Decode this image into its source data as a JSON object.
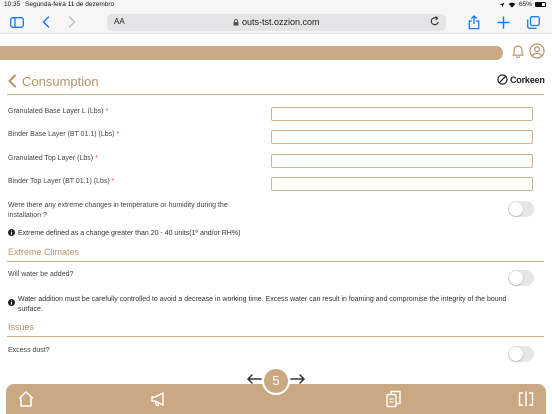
{
  "status_bar": {
    "time": "10:35",
    "date": "Segunda-feira 11 de dezembro",
    "battery": "65%"
  },
  "browser": {
    "text_size_label": "AA",
    "url": "outs-tst.ozzion.com"
  },
  "page": {
    "title": "Consumption",
    "logo_text": "Corkeen"
  },
  "fields": [
    {
      "label": "Granulated Base Layer L (Lbs)",
      "value": "",
      "required_mark": "*"
    },
    {
      "label": "Binder Base Layer (BT 01.1) (Lbs)",
      "value": "",
      "required_mark": "*"
    },
    {
      "label": "Granulated Top Layer  (Lbs)",
      "value": "",
      "required_mark": "*"
    },
    {
      "label": "Binder Top Layer (BT 01.1) (Lbs)",
      "value": "",
      "required_mark": "*"
    }
  ],
  "questions": {
    "extreme_changes": {
      "line1": "Were there any extreme changes in temperature or humidity during the",
      "line2": "installation ?",
      "checked": false
    },
    "extreme_info": "Extreme defined as a change greater than 20 - 40 units(1º and/or RH%)",
    "water": {
      "label": "Will water be added?",
      "checked": false
    },
    "water_info_line1": "Water addition must be carefully controlled to avoid a decrease in working time. Excess water can result in foaming and compromise the integrity of the bound",
    "water_info_line2": "surface.",
    "dust": {
      "label": "Excess dust?",
      "checked": false
    }
  },
  "sections": {
    "extreme_climates": "Extreme Climates",
    "issues": "Issues"
  },
  "pager": {
    "current": "5"
  },
  "colors": {
    "accent": "#caa982",
    "title": "#b8926a",
    "link_blue": "#1a7cf5"
  }
}
